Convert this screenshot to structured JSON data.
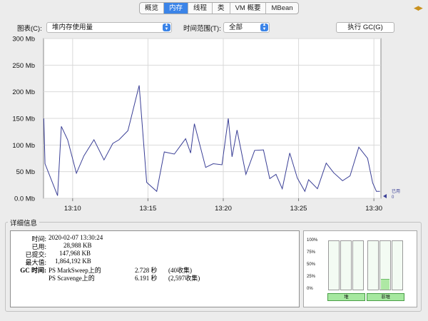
{
  "tabs": [
    "概览",
    "内存",
    "线程",
    "类",
    "VM 概要",
    "MBean"
  ],
  "active_tab": 1,
  "toolbar": {
    "chart_label": "图表(C):",
    "chart_value": "堆内存使用量",
    "time_range_label": "时间范围(T):",
    "time_range_value": "全部",
    "gc_button": "执行 GC(G)"
  },
  "colors": {
    "accent": "#3b84e8",
    "series": "#3a3f96",
    "gauge_fill": "#aee8a4"
  },
  "icons": {
    "nav": "double-arrow-icon",
    "marker": "triangle-marker-icon"
  },
  "chart_data": {
    "type": "line",
    "ylim": [
      0,
      300
    ],
    "y_ticks": [
      "0.0 Mb",
      "50 Mb",
      "100 Mb",
      "150 Mb",
      "200 Mb",
      "250 Mb",
      "300 Mb"
    ],
    "x_ticks": [
      "13:10",
      "13:15",
      "13:20",
      "13:25",
      "13:30"
    ],
    "legend": {
      "label": "已用",
      "value": "0"
    },
    "series": [
      {
        "points": [
          [
            "13:08:05",
            150
          ],
          [
            "13:08:10",
            65
          ],
          [
            "13:09:00",
            5
          ],
          [
            "13:09:15",
            135
          ],
          [
            "13:09:40",
            110
          ],
          [
            "13:10:15",
            47
          ],
          [
            "13:10:45",
            80
          ],
          [
            "13:11:25",
            110
          ],
          [
            "13:12:05",
            72
          ],
          [
            "13:12:40",
            103
          ],
          [
            "13:13:05",
            110
          ],
          [
            "13:13:40",
            127
          ],
          [
            "13:14:25",
            212
          ],
          [
            "13:14:55",
            30
          ],
          [
            "13:15:35",
            13
          ],
          [
            "13:16:05",
            87
          ],
          [
            "13:16:45",
            83
          ],
          [
            "13:17:30",
            112
          ],
          [
            "13:17:50",
            85
          ],
          [
            "13:18:05",
            140
          ],
          [
            "13:18:50",
            58
          ],
          [
            "13:19:20",
            65
          ],
          [
            "13:19:55",
            63
          ],
          [
            "13:20:20",
            150
          ],
          [
            "13:20:35",
            78
          ],
          [
            "13:20:55",
            128
          ],
          [
            "13:21:30",
            45
          ],
          [
            "13:22:05",
            90
          ],
          [
            "13:22:40",
            91
          ],
          [
            "13:23:05",
            37
          ],
          [
            "13:23:30",
            45
          ],
          [
            "13:23:55",
            18
          ],
          [
            "13:24:25",
            85
          ],
          [
            "13:24:55",
            38
          ],
          [
            "13:25:25",
            13
          ],
          [
            "13:25:40",
            35
          ],
          [
            "13:26:15",
            18
          ],
          [
            "13:26:50",
            66
          ],
          [
            "13:27:20",
            48
          ],
          [
            "13:27:55",
            33
          ],
          [
            "13:28:25",
            42
          ],
          [
            "13:29:00",
            96
          ],
          [
            "13:29:35",
            75
          ],
          [
            "13:29:55",
            29
          ],
          [
            "13:30:10",
            13
          ],
          [
            "13:30:24",
            13
          ]
        ]
      }
    ]
  },
  "details": {
    "title": "详细信息",
    "time_label": "时间:",
    "time_value": "2020-02-07 13:30:24",
    "used_label": "已用:",
    "used_value": "28,988 KB",
    "committed_label": "已提交:",
    "committed_value": "147,968 KB",
    "max_label": "最大值:",
    "max_value": "1,864,192 KB",
    "gc_label": "GC 时间:",
    "gc_rows": [
      {
        "name": "PS MarkSweep上的",
        "time": "2.728 秒",
        "count": "(40收集)"
      },
      {
        "name": "PS Scavenge上的",
        "time": "6.191 秒",
        "count": "(2,597收集)"
      }
    ]
  },
  "gauges": {
    "pct_labels": [
      "100%",
      "75%",
      "50%",
      "25%",
      "0%"
    ],
    "heap_label": "堆",
    "nonheap_label": "非堆",
    "heap_levels": [
      0,
      0,
      0
    ],
    "nonheap_levels": [
      0,
      0.22,
      0
    ]
  }
}
